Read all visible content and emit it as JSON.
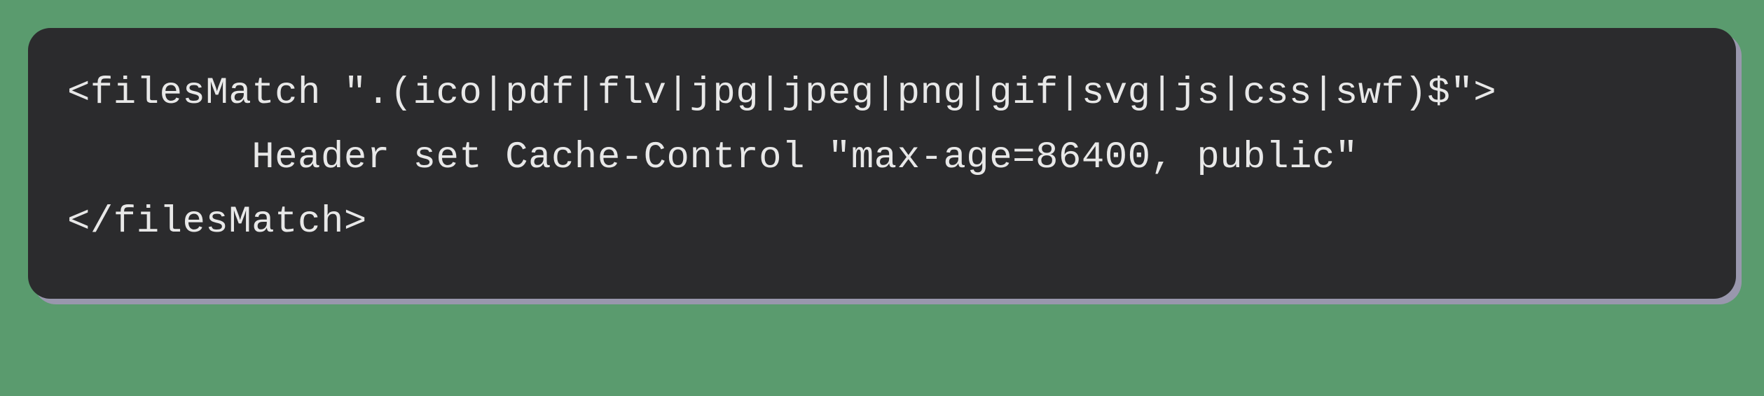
{
  "code": {
    "line1": "<filesMatch \".(ico|pdf|flv|jpg|jpeg|png|gif|svg|js|css|swf)$\">",
    "line2": "        Header set Cache-Control \"max-age=86400, public\"",
    "line3": "</filesMatch>"
  }
}
